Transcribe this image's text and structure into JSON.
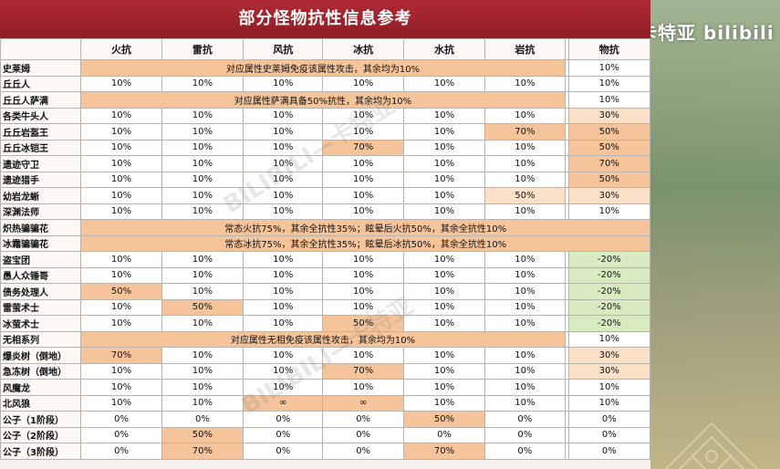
{
  "title": "部分怪物抗性信息参考",
  "watermark": "卡特亚 bilibili",
  "embedded_watermark": "BILIBILI—卡特亚",
  "colors": {
    "title_bg": "#a0242c",
    "highlight_orange": "#f6c49a",
    "highlight_light_orange": "#fbe0c8",
    "highlight_green": "#d9ebc1"
  },
  "headers": [
    "火抗",
    "雷抗",
    "风抗",
    "冰抗",
    "水抗",
    "岩抗",
    "物抗"
  ],
  "rows": [
    {
      "name": "史莱姆",
      "span": "对应属性史莱姆免疫该属性攻击，其余均为10%",
      "phys": "10%"
    },
    {
      "name": "丘丘人",
      "vals": [
        "10%",
        "10%",
        "10%",
        "10%",
        "10%",
        "10%",
        "10%"
      ]
    },
    {
      "name": "丘丘人萨满",
      "span": "对应属性萨满具备50%抗性，其余均为10%",
      "phys": "10%"
    },
    {
      "name": "各类牛头人",
      "vals": [
        "10%",
        "10%",
        "10%",
        "10%",
        "10%",
        "10%",
        "30%"
      ]
    },
    {
      "name": "丘丘岩盔王",
      "vals": [
        "10%",
        "10%",
        "10%",
        "10%",
        "10%",
        "70%",
        "50%"
      ]
    },
    {
      "name": "丘丘冰铠王",
      "vals": [
        "10%",
        "10%",
        "10%",
        "70%",
        "10%",
        "10%",
        "50%"
      ]
    },
    {
      "name": "遗迹守卫",
      "vals": [
        "10%",
        "10%",
        "10%",
        "10%",
        "10%",
        "10%",
        "70%"
      ]
    },
    {
      "name": "遗迹猎手",
      "vals": [
        "10%",
        "10%",
        "10%",
        "10%",
        "10%",
        "10%",
        "50%"
      ]
    },
    {
      "name": "幼岩龙蜥",
      "vals": [
        "10%",
        "10%",
        "10%",
        "10%",
        "10%",
        "50%",
        "30%"
      ]
    },
    {
      "name": "深渊法师",
      "vals": [
        "10%",
        "10%",
        "10%",
        "10%",
        "10%",
        "10%",
        "10%"
      ]
    },
    {
      "name": "炽热骗骗花",
      "span_all": "常态火抗75%，其余全抗性35%；眩晕后火抗50%，其余全抗性10%"
    },
    {
      "name": "冰霜骗骗花",
      "span_all": "常态冰抗75%，其余全抗性35%；眩晕后冰抗50%，其余全抗性10%"
    },
    {
      "name": "盗宝团",
      "vals": [
        "10%",
        "10%",
        "10%",
        "10%",
        "10%",
        "10%",
        "-20%"
      ]
    },
    {
      "name": "愚人众锤哥",
      "vals": [
        "10%",
        "10%",
        "10%",
        "10%",
        "10%",
        "10%",
        "-20%"
      ]
    },
    {
      "name": "债务处理人",
      "vals": [
        "50%",
        "10%",
        "10%",
        "10%",
        "10%",
        "10%",
        "-20%"
      ]
    },
    {
      "name": "雷萤术士",
      "vals": [
        "10%",
        "50%",
        "10%",
        "10%",
        "10%",
        "10%",
        "-20%"
      ]
    },
    {
      "name": "冰萤术士",
      "vals": [
        "10%",
        "10%",
        "10%",
        "50%",
        "10%",
        "10%",
        "-20%"
      ]
    },
    {
      "name": "无相系列",
      "span": "对应属性无相免疫该属性攻击，其余均为10%",
      "phys": "10%"
    },
    {
      "name": "爆炎树（倒地）",
      "vals": [
        "70%",
        "10%",
        "10%",
        "10%",
        "10%",
        "10%",
        "30%"
      ]
    },
    {
      "name": "急冻树（倒地）",
      "vals": [
        "10%",
        "10%",
        "10%",
        "70%",
        "10%",
        "10%",
        "30%"
      ]
    },
    {
      "name": "风魔龙",
      "vals": [
        "10%",
        "10%",
        "10%",
        "10%",
        "10%",
        "10%",
        "10%"
      ]
    },
    {
      "name": "北风狼",
      "vals": [
        "10%",
        "10%",
        "∞",
        "∞",
        "10%",
        "10%",
        "10%"
      ]
    },
    {
      "name": "公子（1阶段）",
      "vals": [
        "0%",
        "0%",
        "0%",
        "0%",
        "50%",
        "0%",
        "0%"
      ]
    },
    {
      "name": "公子（2阶段）",
      "vals": [
        "0%",
        "50%",
        "0%",
        "0%",
        "0%",
        "0%",
        "0%"
      ]
    },
    {
      "name": "公子（3阶段）",
      "vals": [
        "0%",
        "70%",
        "0%",
        "0%",
        "70%",
        "0%",
        "0%"
      ]
    }
  ],
  "highlights": {
    "1": [],
    "3": [
      6
    ],
    "4": [
      5,
      6
    ],
    "5": [
      3,
      6
    ],
    "6": [
      6
    ],
    "7": [
      6
    ],
    "8": [
      5,
      6
    ],
    "12": [
      6
    ],
    "13": [
      6
    ],
    "14": [
      0,
      6
    ],
    "15": [
      1,
      6
    ],
    "16": [
      3,
      6
    ],
    "18": [
      0,
      6
    ],
    "19": [
      3,
      6
    ],
    "21": [
      2,
      3
    ],
    "22": [
      4
    ],
    "23": [
      1
    ],
    "24": [
      1,
      4
    ]
  }
}
